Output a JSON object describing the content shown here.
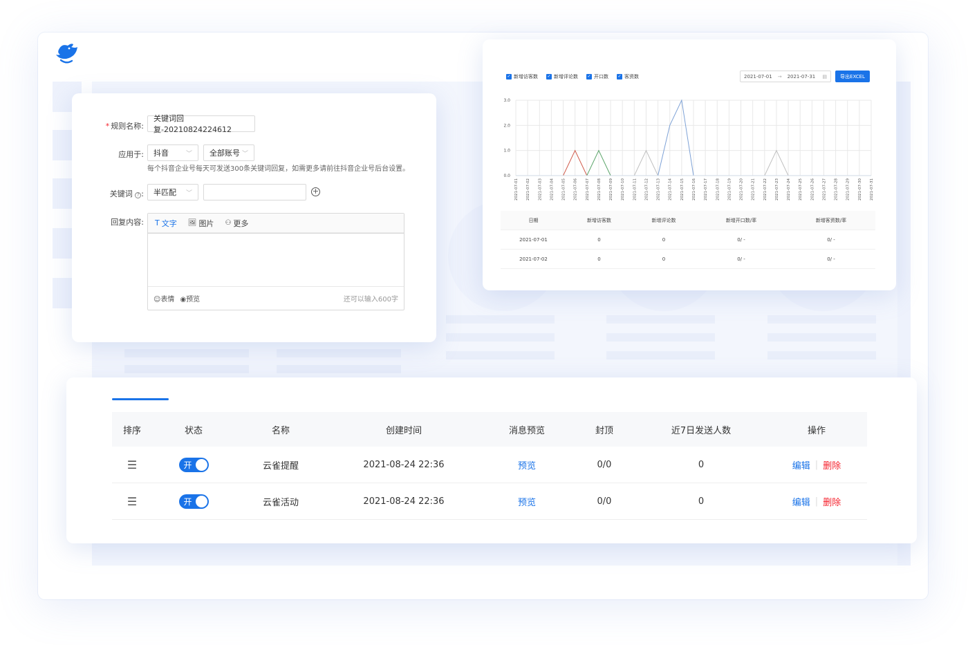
{
  "form": {
    "rule_name_label": "规则名称:",
    "rule_name_value": "关键词回复-20210824224612",
    "apply_label": "应用于:",
    "platform_value": "抖音",
    "account_value": "全部账号",
    "apply_hint": "每个抖音企业号每天可发送300条关键词回复，如需更多请前往抖音企业号后台设置。",
    "keyword_label": "关键词",
    "match_value": "半匹配",
    "reply_label": "回复内容:",
    "tab_text": "文字",
    "tab_image": "图片",
    "tab_more": "更多",
    "emoji_label": "表情",
    "preview_label": "预览",
    "remaining": "还可以输入600字"
  },
  "chart_panel": {
    "legend": [
      "新增访客数",
      "新增评论数",
      "开口数",
      "客资数"
    ],
    "date_start": "2021-07-01",
    "date_sep": "→",
    "date_end": "2021-07-31",
    "export_label": "导出EXCEL",
    "table_headers": [
      "日期",
      "新增访客数",
      "新增评论数",
      "新增开口数/率",
      "新增客资数/率"
    ],
    "table_rows": [
      [
        "2021-07-01",
        "0",
        "0",
        "0/ -",
        "0/ -"
      ],
      [
        "2021-07-02",
        "0",
        "0",
        "0/ -",
        "0/ -"
      ]
    ]
  },
  "chart_data": {
    "type": "line",
    "x": [
      "2021-07-01",
      "2021-07-02",
      "2021-07-03",
      "2021-07-04",
      "2021-07-05",
      "2021-07-06",
      "2021-07-07",
      "2021-07-08",
      "2021-07-09",
      "2021-07-10",
      "2021-07-11",
      "2021-07-12",
      "2021-07-13",
      "2021-07-14",
      "2021-07-15",
      "2021-07-16",
      "2021-07-17",
      "2021-07-18",
      "2021-07-19",
      "2021-07-20",
      "2021-07-21",
      "2021-07-22",
      "2021-07-23",
      "2021-07-24",
      "2021-07-25",
      "2021-07-26",
      "2021-07-27",
      "2021-07-28",
      "2021-07-29",
      "2021-07-30",
      "2021-07-31"
    ],
    "yticks": [
      "0.0",
      "1.0",
      "2.0",
      "3.0"
    ],
    "ylim": [
      0,
      3
    ],
    "grid": true,
    "series": [
      {
        "name": "新增访客数",
        "color": "#d05a4a",
        "values": [
          0,
          0,
          0,
          0,
          0,
          1,
          0,
          0,
          0,
          0,
          0,
          0,
          0,
          0,
          0,
          0,
          0,
          0,
          0,
          0,
          0,
          0,
          0,
          0,
          0,
          0,
          0,
          0,
          0,
          0,
          0
        ]
      },
      {
        "name": "新增评论数",
        "color": "#5aa469",
        "values": [
          0,
          0,
          0,
          0,
          0,
          0,
          0,
          1,
          0,
          0,
          0,
          0,
          0,
          0,
          0,
          0,
          0,
          0,
          0,
          0,
          0,
          0,
          0,
          0,
          0,
          0,
          0,
          0,
          0,
          0,
          0
        ]
      },
      {
        "name": "开口数",
        "color": "#bfbfbf",
        "values": [
          0,
          0,
          0,
          0,
          0,
          0,
          0,
          0,
          0,
          0,
          0,
          1,
          0,
          0,
          0,
          0,
          0,
          0,
          0,
          0,
          0,
          0,
          1,
          0,
          0,
          0,
          0,
          0,
          0,
          0,
          0
        ]
      },
      {
        "name": "客资数",
        "color": "#7ea2d6",
        "values": [
          0,
          0,
          0,
          0,
          0,
          0,
          0,
          0,
          0,
          0,
          0,
          0,
          0,
          2,
          3,
          0,
          0,
          0,
          0,
          0,
          0,
          0,
          0,
          0,
          0,
          0,
          0,
          0,
          0,
          0,
          0
        ]
      }
    ]
  },
  "table": {
    "headers": [
      "排序",
      "状态",
      "名称",
      "创建时间",
      "消息预览",
      "封顶",
      "近7日发送人数",
      "操作"
    ],
    "rows": [
      {
        "toggle": "开",
        "name": "云雀提醒",
        "created": "2021-08-24 22:36",
        "preview": "预览",
        "cap": "0/0",
        "sent": "0",
        "edit": "编辑",
        "delete": "删除"
      },
      {
        "toggle": "开",
        "name": "云雀活动",
        "created": "2021-08-24 22:36",
        "preview": "预览",
        "cap": "0/0",
        "sent": "0",
        "edit": "编辑",
        "delete": "删除"
      }
    ]
  },
  "colors": {
    "accent": "#1a73e8",
    "danger": "#f5222d"
  }
}
